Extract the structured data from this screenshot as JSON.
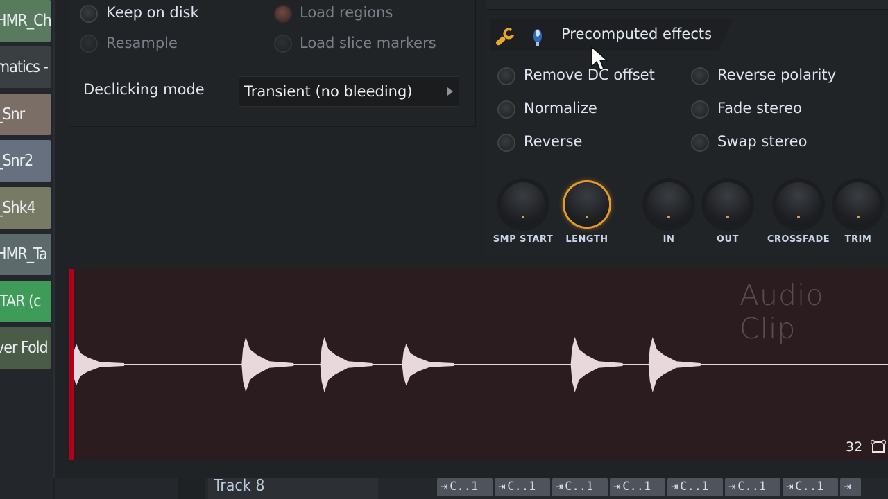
{
  "left_patterns": [
    {
      "label": "HMR_Ch",
      "color": "#5a7a5f"
    },
    {
      "label": "matics -",
      "color": "#3a3f42"
    },
    {
      "label": "_Snr",
      "color": "#7a6e66"
    },
    {
      "label": "_Snr2",
      "color": "#66707e"
    },
    {
      "label": "_Shk4",
      "color": "#777a64"
    },
    {
      "label": "HMR_Ta",
      "color": "#5d6a6c"
    },
    {
      "label": "ITAR (c",
      "color": "#3f9c58"
    },
    {
      "label": "ver Fold",
      "color": "#4a5b48"
    }
  ],
  "load_options": {
    "keep_on_disk": {
      "label": "Keep on disk",
      "checked": false,
      "enabled": true
    },
    "resample": {
      "label": "Resample",
      "checked": false,
      "enabled": false
    },
    "load_regions": {
      "label": "Load regions",
      "checked": true,
      "enabled": false
    },
    "load_slice_markers": {
      "label": "Load slice markers",
      "checked": false,
      "enabled": false
    }
  },
  "declicking": {
    "label": "Declicking mode",
    "value": "Transient (no bleeding)"
  },
  "effects": {
    "title": "Precomputed effects",
    "options": [
      {
        "label": "Remove DC offset",
        "checked": false
      },
      {
        "label": "Normalize",
        "checked": false
      },
      {
        "label": "Reverse",
        "checked": false
      },
      {
        "label": "Reverse polarity",
        "checked": false
      },
      {
        "label": "Fade stereo",
        "checked": false
      },
      {
        "label": "Swap stereo",
        "checked": false
      }
    ],
    "knobs": [
      {
        "label": "SMP START",
        "active": false
      },
      {
        "label": "LENGTH",
        "active": true
      },
      {
        "label": "IN",
        "active": false
      },
      {
        "label": "OUT",
        "active": false
      },
      {
        "label": "CROSSFADE",
        "active": false
      },
      {
        "label": "TRIM",
        "active": false
      }
    ]
  },
  "waveform": {
    "watermark": "Audio Clip",
    "count_label": "32",
    "background": "#2b1c20",
    "wave_color": "#e8d8dc",
    "playhead_color": "#b0001a",
    "hits": [
      0.0,
      0.207,
      0.303,
      0.403,
      0.609,
      0.704
    ]
  },
  "bottom": {
    "track_name": "Track 8",
    "clips": [
      "C..1",
      "C..1",
      "C..1",
      "C..1",
      "C..1",
      "C..1",
      "C..1",
      ""
    ]
  }
}
